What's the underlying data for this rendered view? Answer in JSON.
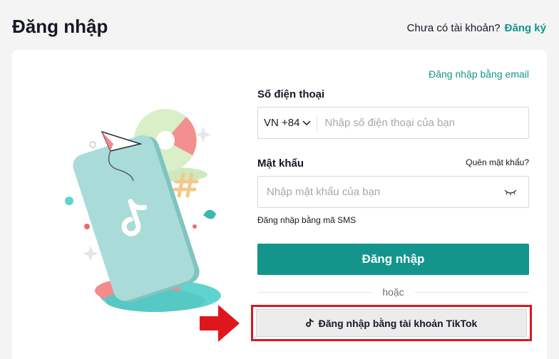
{
  "header": {
    "title": "Đăng nhập",
    "no_account_text": "Chưa có tài khoản?",
    "signup_link": "Đăng ký"
  },
  "form": {
    "email_login_link": "Đăng nhập bằng email",
    "phone_label": "Số điện thoại",
    "country_code": "VN +84",
    "phone_placeholder": "Nhập số điện thoại của bạn",
    "password_label": "Mật khẩu",
    "forgot_password": "Quên mật khẩu?",
    "password_placeholder": "Nhập mật khẩu của bạn",
    "sms_login_link": "Đăng nhập bằng mã SMS",
    "login_button": "Đăng nhập",
    "or_text": "hoặc",
    "tiktok_button": "Đăng nhập bằng tài khoản TikTok"
  },
  "colors": {
    "brand_teal": "#13958c",
    "highlight_red": "#e0161e"
  },
  "icons": [
    "tiktok-note-icon",
    "chevron-down-icon",
    "eye-closed-icon",
    "red-arrow-icon"
  ]
}
